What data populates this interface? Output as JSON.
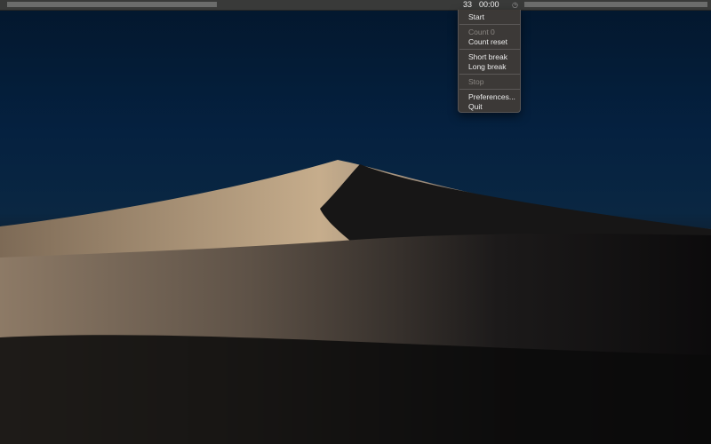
{
  "status_bar": {
    "count": "33",
    "timer": "00:00",
    "icon": "clock-icon"
  },
  "menu": {
    "start": "Start",
    "count_label": "Count 0",
    "count_reset": "Count reset",
    "short_break": "Short break",
    "long_break": "Long break",
    "stop": "Stop",
    "preferences": "Preferences...",
    "quit": "Quit"
  }
}
